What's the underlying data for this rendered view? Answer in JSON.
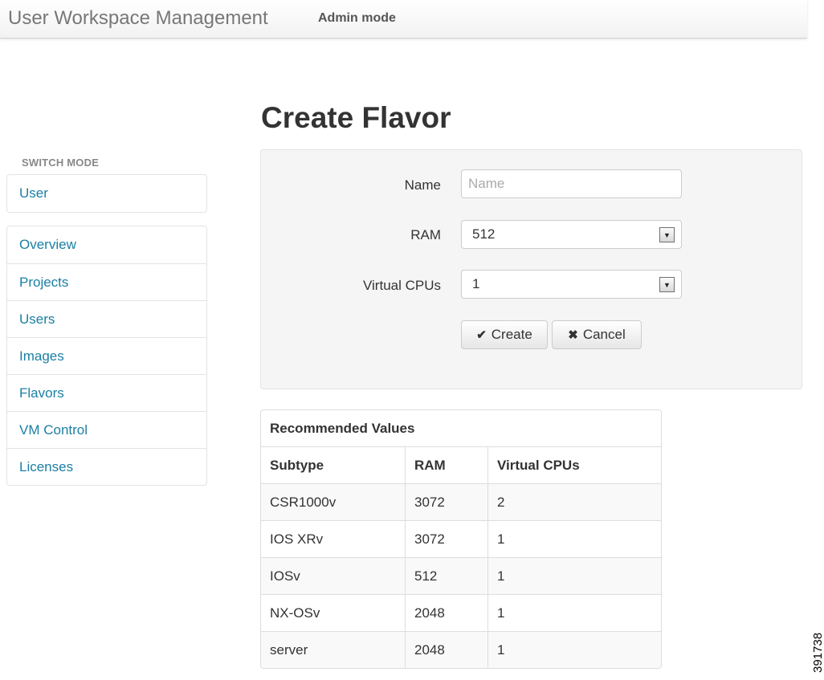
{
  "header": {
    "brand": "User Workspace Management",
    "mode": "Admin mode"
  },
  "sidebar": {
    "section_label": "SWITCH MODE",
    "switch_items": [
      {
        "label": "User"
      }
    ],
    "items": [
      {
        "label": "Overview"
      },
      {
        "label": "Projects"
      },
      {
        "label": "Users"
      },
      {
        "label": "Images"
      },
      {
        "label": "Flavors"
      },
      {
        "label": "VM Control"
      },
      {
        "label": "Licenses"
      }
    ]
  },
  "page": {
    "title": "Create Flavor"
  },
  "form": {
    "name": {
      "label": "Name",
      "value": "",
      "placeholder": "Name"
    },
    "ram": {
      "label": "RAM",
      "value": "512"
    },
    "vcpus": {
      "label": "Virtual CPUs",
      "value": "1"
    },
    "create_label": "Create",
    "cancel_label": "Cancel",
    "create_icon": "checkmark-icon",
    "cancel_icon": "close-icon"
  },
  "recommended": {
    "caption": "Recommended Values",
    "columns": [
      "Subtype",
      "RAM",
      "Virtual CPUs"
    ],
    "rows": [
      [
        "CSR1000v",
        "3072",
        "2"
      ],
      [
        "IOS XRv",
        "3072",
        "1"
      ],
      [
        "IOSv",
        "512",
        "1"
      ],
      [
        "NX-OSv",
        "2048",
        "1"
      ],
      [
        "server",
        "2048",
        "1"
      ]
    ]
  },
  "figure_id": "391738",
  "colors": {
    "link": "#1a7fa3",
    "panel_bg": "#f5f5f5",
    "text": "#333333"
  }
}
